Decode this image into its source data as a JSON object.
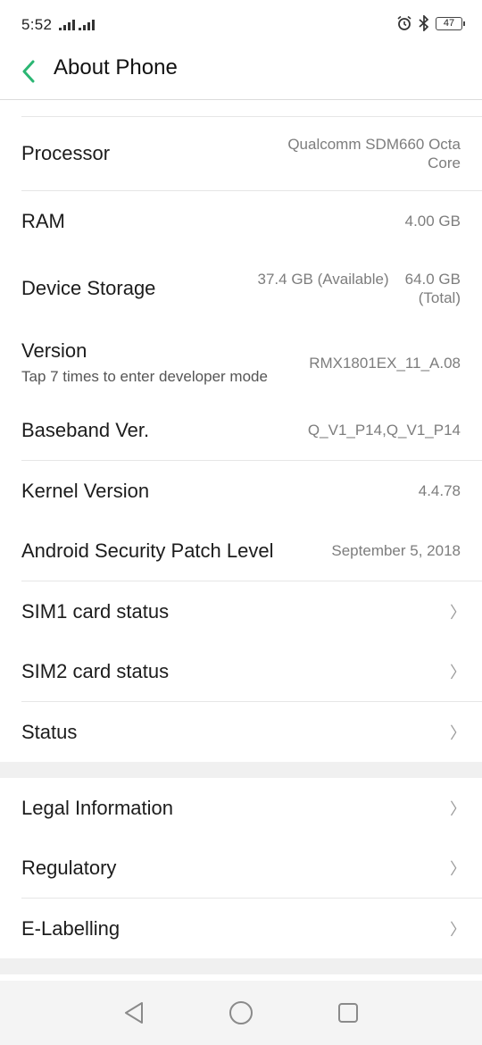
{
  "status_bar": {
    "time": "5:52",
    "battery": "47",
    "icons": [
      "signal-icon",
      "signal-icon",
      "alarm-icon",
      "bluetooth-icon",
      "battery-icon"
    ]
  },
  "app_bar": {
    "title": "About Phone",
    "back_icon": "chevron-left-icon",
    "accent": "#2bb673"
  },
  "items": {
    "processor": {
      "label": "Processor",
      "value_line1": "Qualcomm SDM660 Octa",
      "value_line2": "Core"
    },
    "ram": {
      "label": "RAM",
      "value": "4.00 GB"
    },
    "storage": {
      "label": "Device Storage",
      "available_line1": "37.4 GB (Available)",
      "total_line1": "64.0 GB",
      "total_line2": "(Total)"
    },
    "version": {
      "label": "Version",
      "sub": "Tap 7 times to enter developer mode",
      "value": "RMX1801EX_11_A.08"
    },
    "baseband": {
      "label": "Baseband Ver.",
      "value": "Q_V1_P14,Q_V1_P14"
    },
    "kernel": {
      "label": "Kernel Version",
      "value": "4.4.78"
    },
    "security_patch": {
      "label": "Android Security Patch Level",
      "value": "September 5, 2018"
    },
    "sim1": {
      "label": "SIM1 card status"
    },
    "sim2": {
      "label": "SIM2 card status"
    },
    "status": {
      "label": "Status"
    },
    "legal": {
      "label": "Legal Information"
    },
    "regulatory": {
      "label": "Regulatory"
    },
    "elabelling": {
      "label": "E-Labelling"
    }
  },
  "chevron": "〉",
  "nav_bar": {
    "icons": [
      "back-icon",
      "home-icon",
      "recents-icon"
    ]
  }
}
